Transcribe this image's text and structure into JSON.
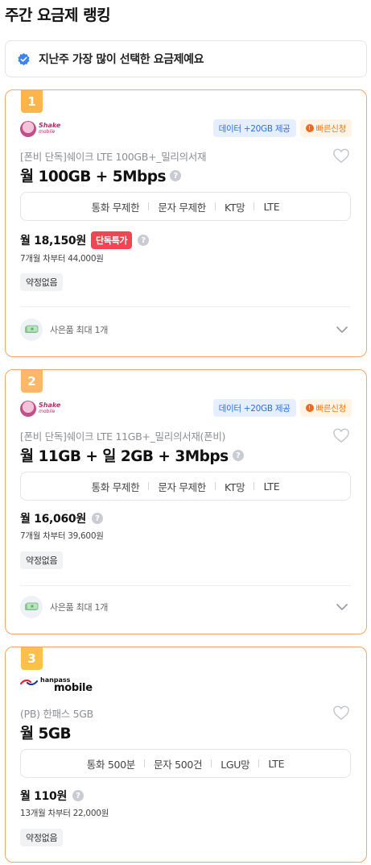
{
  "page": {
    "title": "주간 요금제 랭킹"
  },
  "notice": {
    "text": "지난주 가장 많이 선택한 요금제예요",
    "icon": "verified-check-icon",
    "color": "#3b82f6"
  },
  "plans": [
    {
      "rank": "1",
      "carrier_logo": {
        "line1": "Shake",
        "line2": "mobile"
      },
      "badges": {
        "data": "데이터 +20GB 제공",
        "fast": "빠른신청"
      },
      "subtitle": "[폰비 단독]쉐이크 LTE 100GB+_밀리의서재",
      "title": "월 100GB + 5Mbps",
      "features": [
        "통화 무제한",
        "문자 무제한",
        "KT망",
        "LTE"
      ],
      "price": "월 18,150원",
      "promo": "단독특가",
      "after_price": "7개월 차부터 44,000원",
      "contract": "약정없음",
      "gift": "사은품 최대 1개"
    },
    {
      "rank": "2",
      "carrier_logo": {
        "line1": "Shake",
        "line2": "mobile"
      },
      "badges": {
        "data": "데이터 +20GB 제공",
        "fast": "빠른신청"
      },
      "subtitle": "[폰비 단독]쉐이크 LTE 11GB+_밀리의서재(폰비)",
      "title": "월 11GB + 일 2GB + 3Mbps",
      "features": [
        "통화 무제한",
        "문자 무제한",
        "KT망",
        "LTE"
      ],
      "price": "월 16,060원",
      "after_price": "7개월 차부터 39,600원",
      "contract": "약정없음",
      "gift": "사은품 최대 1개"
    },
    {
      "rank": "3",
      "carrier_logo": {
        "line1": "hanpass",
        "line2": "mobile"
      },
      "subtitle": "(PB) 한패스 5GB",
      "title": "월 5GB",
      "features": [
        "통화 500분",
        "문자 500건",
        "LGU망",
        "LTE"
      ],
      "price": "월 110원",
      "after_price": "13개월 차부터 22,000원",
      "contract": "약정없음"
    }
  ],
  "colors": {
    "card_border": "#f5a66a",
    "rank_badge": "#fdb54b",
    "promo_red": "#f04552",
    "data_badge_blue": "#2f6fe4"
  }
}
